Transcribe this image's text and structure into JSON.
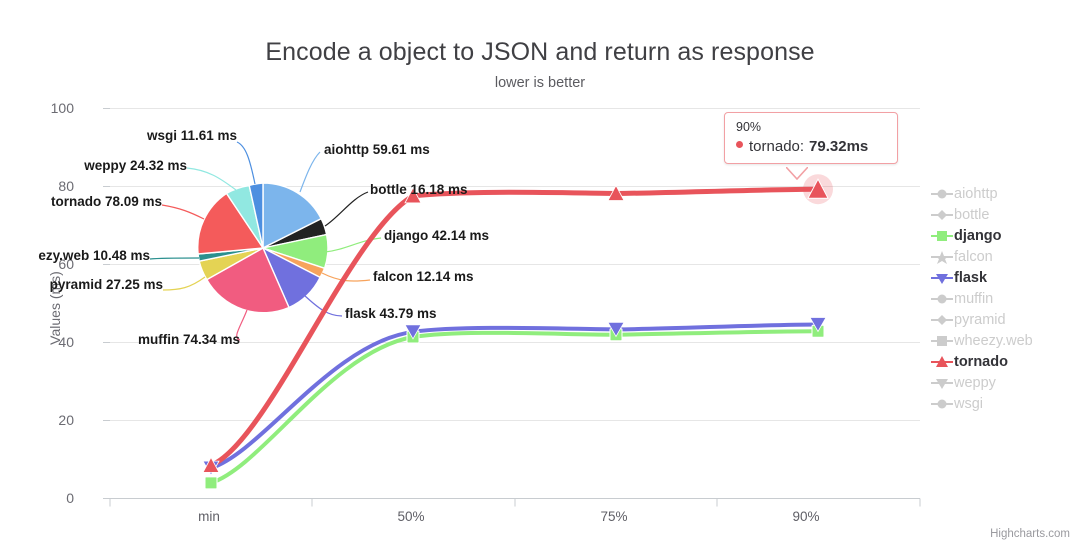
{
  "chart_data": {
    "type": "line",
    "title": "Encode a object to JSON and return as response",
    "subtitle": "lower is better",
    "xlabel": "",
    "ylabel": "Values (ms)",
    "categories": [
      "min",
      "50%",
      "75%",
      "90%"
    ],
    "ylim": [
      0,
      100
    ],
    "yticks": [
      "0",
      "20",
      "40",
      "60",
      "80",
      "100"
    ],
    "grid": true,
    "legend_position": "right",
    "series": [
      {
        "name": "django",
        "values": [
          4.0,
          41.4,
          42.0,
          42.9
        ],
        "color": "#90ed7d",
        "visible": true,
        "marker": "square"
      },
      {
        "name": "flask",
        "values": [
          7.8,
          43.0,
          43.6,
          44.6
        ],
        "color": "#7070de",
        "visible": true,
        "marker": "triangle-down"
      },
      {
        "name": "tornado",
        "values": [
          8.5,
          77.6,
          78.2,
          79.32
        ],
        "color": "#e8545b",
        "visible": true,
        "marker": "triangle-up"
      },
      {
        "name": "aiohttp",
        "values": [],
        "color": "#cccccc",
        "visible": false,
        "marker": "circle"
      },
      {
        "name": "bottle",
        "values": [],
        "color": "#cccccc",
        "visible": false,
        "marker": "diamond"
      },
      {
        "name": "falcon",
        "values": [],
        "color": "#cccccc",
        "visible": false,
        "marker": "star"
      },
      {
        "name": "muffin",
        "values": [],
        "color": "#cccccc",
        "visible": false,
        "marker": "circle"
      },
      {
        "name": "pyramid",
        "values": [],
        "color": "#cccccc",
        "visible": false,
        "marker": "diamond"
      },
      {
        "name": "wheezy.web",
        "values": [],
        "color": "#cccccc",
        "visible": false,
        "marker": "square"
      },
      {
        "name": "weppy",
        "values": [],
        "color": "#cccccc",
        "visible": false,
        "marker": "triangle-down"
      },
      {
        "name": "wsgi",
        "values": [],
        "color": "#cccccc",
        "visible": false,
        "marker": "circle"
      }
    ],
    "pie": {
      "type": "pie",
      "labels": [
        "aiohttp",
        "bottle",
        "django",
        "falcon",
        "flask",
        "muffin",
        "pyramid",
        "wheezy.web",
        "tornado",
        "weppy",
        "wsgi"
      ],
      "values": [
        59.61,
        16.18,
        42.14,
        12.14,
        43.79,
        74.34,
        27.25,
        10.48,
        78.09,
        24.32,
        11.61
      ],
      "colors": [
        "#7cb5ec",
        "#222222",
        "#90ed7d",
        "#f7a35c",
        "#7070de",
        "#f15c80",
        "#e4d354",
        "#2b908f",
        "#f45b5b",
        "#91e8e1",
        "#4d8fe0"
      ],
      "unit": "ms"
    }
  },
  "tooltip": {
    "header": "90%",
    "series_name": "tornado:",
    "value": "79.32ms",
    "dot_color": "#e8545b",
    "border_color": "#f2a0a4"
  },
  "pie_labels": [
    {
      "text": "wsgi 11.61 ms",
      "side": "left"
    },
    {
      "text": "weppy 24.32 ms",
      "side": "left"
    },
    {
      "text": "tornado 78.09 ms",
      "side": "left"
    },
    {
      "text": "ezy.web 10.48 ms",
      "side": "left"
    },
    {
      "text": "pyramid 27.25 ms",
      "side": "left"
    },
    {
      "text": "muffin 74.34 ms",
      "side": "left"
    },
    {
      "text": "aiohttp 59.61 ms",
      "side": "right"
    },
    {
      "text": "bottle 16.18 ms",
      "side": "right"
    },
    {
      "text": "django 42.14 ms",
      "side": "right"
    },
    {
      "text": "falcon 12.14 ms",
      "side": "right"
    },
    {
      "text": "flask 43.79 ms",
      "side": "right"
    }
  ],
  "credits": "Highcharts.com"
}
